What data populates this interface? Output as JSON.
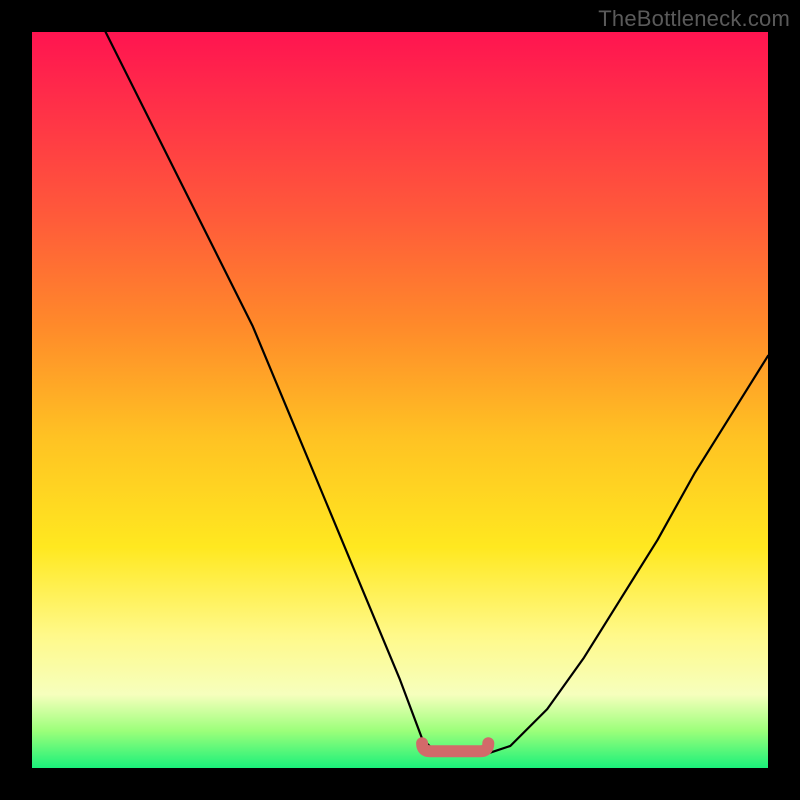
{
  "watermark": "TheBottleneck.com",
  "chart_data": {
    "type": "line",
    "title": "",
    "xlabel": "",
    "ylabel": "",
    "xlim": [
      0,
      100
    ],
    "ylim": [
      0,
      100
    ],
    "series": [
      {
        "name": "curve",
        "x": [
          10,
          15,
          20,
          25,
          30,
          35,
          40,
          45,
          50,
          53,
          55,
          57,
          60,
          62,
          65,
          70,
          75,
          80,
          85,
          90,
          95,
          100
        ],
        "values": [
          100,
          90,
          80,
          70,
          60,
          48,
          36,
          24,
          12,
          4,
          2,
          2,
          2,
          2,
          3,
          8,
          15,
          23,
          31,
          40,
          48,
          56
        ]
      }
    ],
    "marker_segment": {
      "x_start": 53,
      "x_end": 62,
      "y": 2
    },
    "gradient_stops": [
      {
        "pos": 0.0,
        "color": "#ff1450"
      },
      {
        "pos": 0.25,
        "color": "#ff5a3a"
      },
      {
        "pos": 0.55,
        "color": "#ffc223"
      },
      {
        "pos": 0.82,
        "color": "#fff98a"
      },
      {
        "pos": 1.0,
        "color": "#1af07a"
      }
    ]
  }
}
